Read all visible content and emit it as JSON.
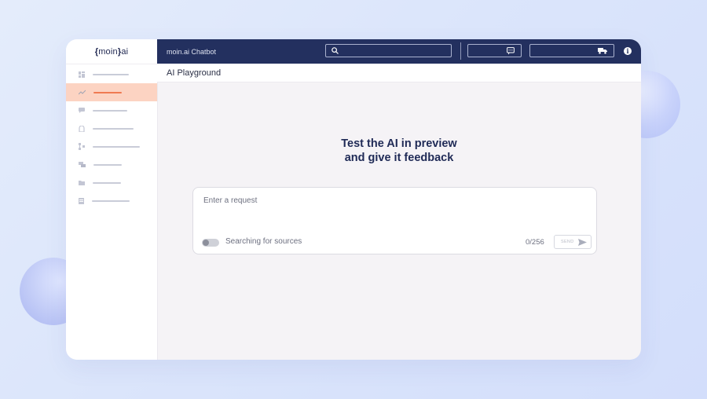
{
  "app": {
    "logo": {
      "open_brace": "{",
      "name": "moin",
      "close_brace": "}",
      "suffix": "ai"
    },
    "topbar": {
      "title": "moin.ai Chatbot"
    },
    "breadcrumb": "AI Playground"
  },
  "sidebar": {
    "items": [
      {
        "icon": "dashboard-icon",
        "active": false
      },
      {
        "icon": "analytics-chart-icon",
        "active": true
      },
      {
        "icon": "chat-icon",
        "active": false
      },
      {
        "icon": "bot-icon",
        "active": false
      },
      {
        "icon": "flow-icon",
        "active": false
      },
      {
        "icon": "messages-icon",
        "active": false
      },
      {
        "icon": "folder-icon",
        "active": false
      },
      {
        "icon": "document-icon",
        "active": false
      }
    ]
  },
  "main": {
    "hero_line1": "Test the AI in preview",
    "hero_line2": "and give it feedback",
    "request": {
      "placeholder": "Enter a request",
      "value": "",
      "toggle_label": "Searching for sources",
      "toggle_on": false,
      "counter": "0/256",
      "send_label": "SEND"
    }
  },
  "colors": {
    "topbar": "#23305f",
    "active_nav_bg": "#fcd3c2",
    "active_nav_accent": "#f07a52",
    "heading": "#1f2a56"
  }
}
